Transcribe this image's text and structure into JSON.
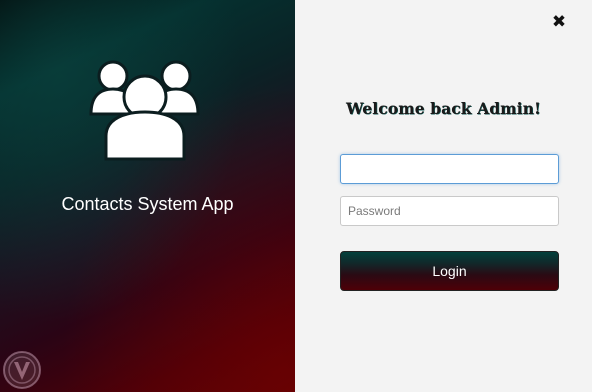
{
  "left_panel": {
    "app_title": "Contacts System App",
    "icon": "users-group-icon",
    "watermark_icon": "shield-logo-icon"
  },
  "right_panel": {
    "close_icon": "close-icon",
    "close_glyph": "✖",
    "welcome_text": "Welcome back Admin!",
    "username": {
      "value": "",
      "placeholder": ""
    },
    "password": {
      "value": "",
      "placeholder": "Password"
    },
    "login_label": "Login"
  },
  "colors": {
    "right_bg": "#f3f3f3",
    "focus_border": "#5c9cd6",
    "gradient_teal": "#05302f",
    "gradient_red": "#5a0204"
  }
}
